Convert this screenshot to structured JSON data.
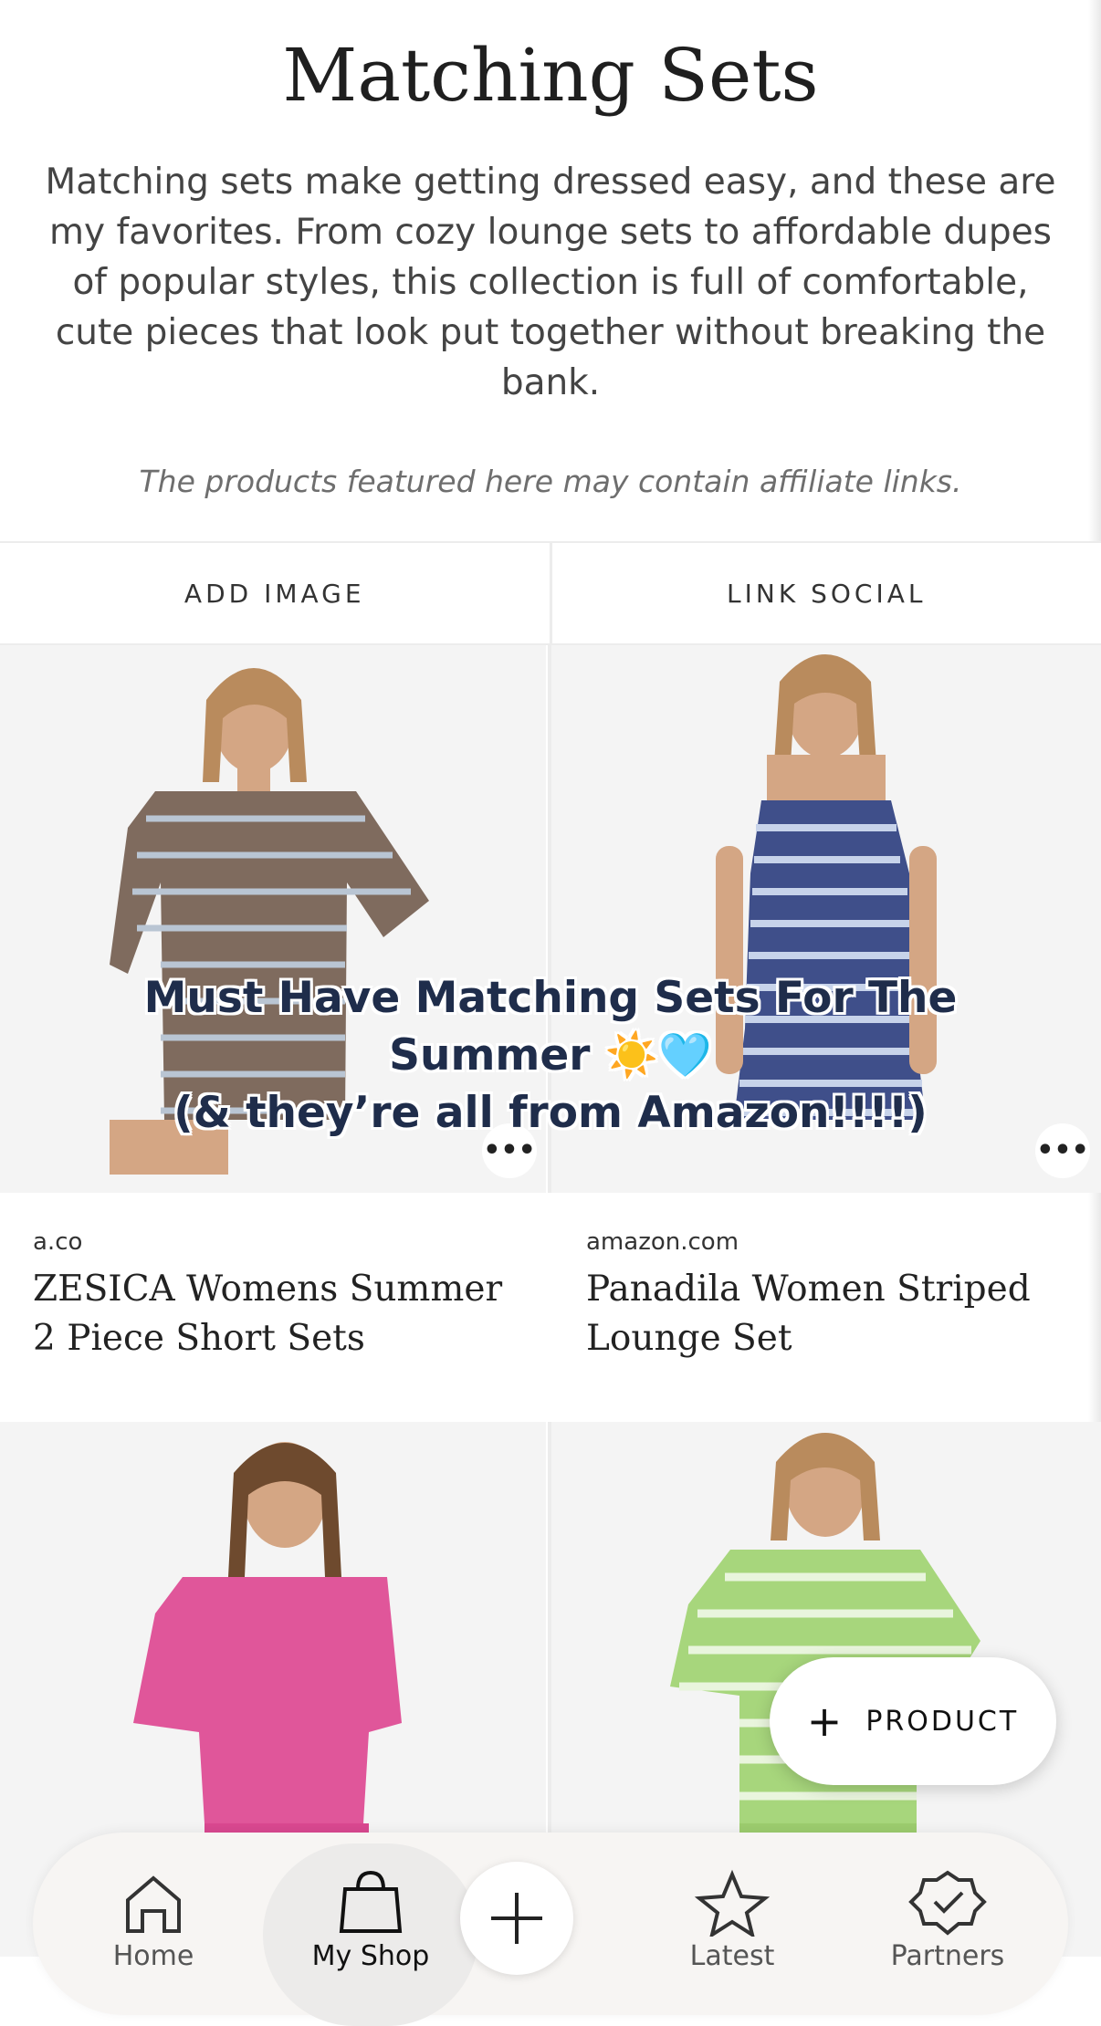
{
  "page": {
    "title": "Matching Sets",
    "description": "Matching sets make getting dressed easy, and these are my favorites. From cozy lounge sets to affordable dupes of popular styles, this collection is full of comfortable, cute pieces that look put together without breaking the bank.",
    "disclaimer": "The products featured here may contain affiliate links."
  },
  "actions": {
    "add_image": "ADD IMAGE",
    "link_social": "LINK SOCIAL"
  },
  "overlay": {
    "line1": "Must Have Matching Sets For The",
    "line2": "Summer ☀️🩵",
    "line3": "(& they’re all from Amazon!!!!)"
  },
  "products": [
    {
      "source": "a.co",
      "name": "ZESICA Womens Summer 2 Piece Short Sets",
      "color": "#7d6a5c"
    },
    {
      "source": "amazon.com",
      "name": "Panadila Women Striped Lounge Set",
      "color": "#3f4f8a"
    },
    {
      "source": "",
      "name": "",
      "color": "#e0569a"
    },
    {
      "source": "",
      "name": "",
      "color": "#9ccc6e"
    }
  ],
  "fab": {
    "label": "PRODUCT"
  },
  "tabs": {
    "home": "Home",
    "my_shop": "My Shop",
    "latest": "Latest",
    "partners": "Partners"
  },
  "icons": {
    "more": "ellipsis-icon",
    "plus": "plus-icon",
    "home": "home-icon",
    "shop": "shopping-bag-icon",
    "latest": "star-icon",
    "partners": "verified-badge-icon"
  }
}
